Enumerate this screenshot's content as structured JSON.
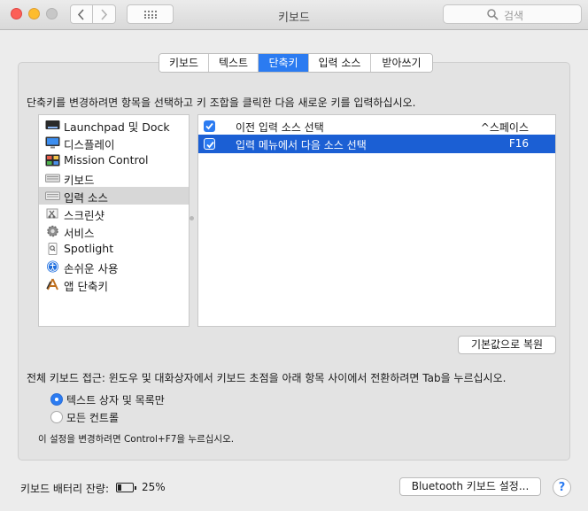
{
  "window": {
    "title": "키보드"
  },
  "search": {
    "placeholder": "검색"
  },
  "tabs": [
    {
      "label": "키보드",
      "active": false
    },
    {
      "label": "텍스트",
      "active": false
    },
    {
      "label": "단축키",
      "active": true
    },
    {
      "label": "입력 소스",
      "active": false
    },
    {
      "label": "받아쓰기",
      "active": false
    }
  ],
  "instruction": "단축키를 변경하려면 항목을 선택하고 키 조합을 클릭한 다음 새로운 키를 입력하십시오.",
  "categories": [
    {
      "label": "Launchpad 및 Dock",
      "icon": "launchpad-icon"
    },
    {
      "label": "디스플레이",
      "icon": "display-icon"
    },
    {
      "label": "Mission Control",
      "icon": "mission-control-icon"
    },
    {
      "label": "키보드",
      "icon": "keyboard-icon"
    },
    {
      "label": "입력 소스",
      "icon": "input-sources-icon",
      "selected": true
    },
    {
      "label": "스크린샷",
      "icon": "screenshot-icon"
    },
    {
      "label": "서비스",
      "icon": "services-gear-icon"
    },
    {
      "label": "Spotlight",
      "icon": "spotlight-icon"
    },
    {
      "label": "손쉬운 사용",
      "icon": "accessibility-icon"
    },
    {
      "label": "앱 단축키",
      "icon": "app-shortcuts-icon"
    }
  ],
  "shortcuts": [
    {
      "name": "이전 입력 소스 선택",
      "key": "^스페이스",
      "checked": true,
      "selected": false
    },
    {
      "name": "입력 메뉴에서 다음 소스 선택",
      "key": "F16",
      "checked": true,
      "selected": true
    }
  ],
  "restore_button": "기본값으로 복원",
  "full_keyboard_access": {
    "label": "전체 키보드 접근: 윈도우 및 대화상자에서 키보드 초점을 아래 항목 사이에서 전환하려면 Tab을 누르십시오.",
    "options": [
      {
        "label": "텍스트 상자 및 목록만",
        "selected": true
      },
      {
        "label": "모든 컨트롤",
        "selected": false
      }
    ],
    "hint": "이 설정을 변경하려면 Control+F7을 누르십시오."
  },
  "battery": {
    "label": "키보드 배터리 잔량:",
    "percent_text": "25%",
    "level": 0.25
  },
  "bluetooth_button": "Bluetooth 키보드 설정...",
  "help_button": "?"
}
